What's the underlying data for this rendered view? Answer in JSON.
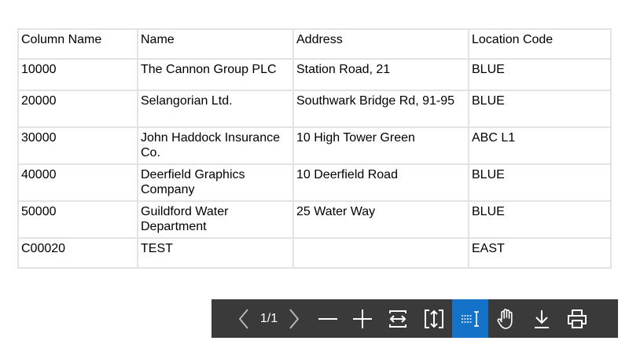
{
  "table": {
    "headers": [
      "Column Name",
      "Name",
      "Address",
      "Location Code"
    ],
    "rows": [
      [
        "10000",
        "The Cannon Group PLC",
        "Station Road, 21",
        "BLUE"
      ],
      [
        "20000",
        "Selangorian Ltd.",
        "Southwark Bridge Rd, 91-95",
        "BLUE"
      ],
      [
        "30000",
        "John Haddock Insurance Co.",
        "10 High Tower Green",
        "ABC L1"
      ],
      [
        "40000",
        "Deerfield Graphics Company",
        "10 Deerfield Road",
        "BLUE"
      ],
      [
        "50000",
        "Guildford Water Department",
        "25 Water Way",
        "BLUE"
      ],
      [
        "C00020",
        "TEST",
        "",
        "EAST"
      ]
    ]
  },
  "toolbar": {
    "page_indicator": "1/1",
    "background_color": "#3a3a3a",
    "active_color": "#1473c9",
    "icons": [
      "chevron-left-icon",
      "chevron-right-icon",
      "zoom-out-icon",
      "zoom-in-icon",
      "fit-width-icon",
      "fit-page-icon",
      "text-select-icon",
      "hand-pan-icon",
      "download-icon",
      "print-icon"
    ],
    "active_tool": "text-select"
  }
}
